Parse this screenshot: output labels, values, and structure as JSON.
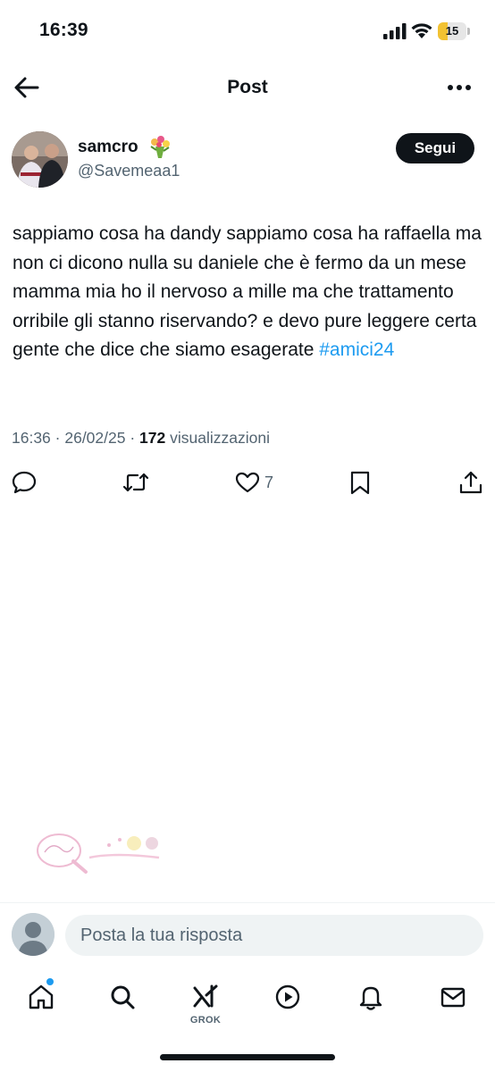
{
  "status_bar": {
    "time": "16:39",
    "battery_level": "15",
    "battery_fraction": 0.15
  },
  "header": {
    "title": "Post",
    "back_icon": "arrow-left-icon",
    "more_icon": "more-horizontal-icon"
  },
  "tweet": {
    "author_name": "samcro",
    "author_emoji": "bouquet-emoji",
    "author_handle": "@Savemeaa1",
    "follow_label": "Segui",
    "text_main": "sappiamo cosa ha dandy sappiamo cosa ha raffaella ma non ci dicono nulla su daniele che è fermo da un mese mamma mia ho il nervoso a mille ma che trattamento orribile gli stanno riservando? e devo pure leggere certa gente che dice che siamo esagerate ",
    "hashtag": "#amici24",
    "time": "16:36",
    "date": "26/02/25",
    "views_count": "172",
    "views_label": "visualizzazioni",
    "like_count": "7"
  },
  "actions": [
    {
      "icon": "reply-icon"
    },
    {
      "icon": "retweet-icon"
    },
    {
      "icon": "like-icon"
    },
    {
      "icon": "bookmark-icon"
    },
    {
      "icon": "share-icon"
    }
  ],
  "reply_bar": {
    "placeholder": "Posta la tua risposta"
  },
  "bottom_nav": {
    "items": [
      {
        "icon": "home-icon"
      },
      {
        "icon": "search-icon"
      },
      {
        "icon": "grok-icon",
        "label": "GROK"
      },
      {
        "icon": "video-icon"
      },
      {
        "icon": "notifications-icon"
      },
      {
        "icon": "messages-icon"
      }
    ]
  },
  "colors": {
    "text": "#0f1419",
    "secondary": "#536471",
    "accent": "#1d9bf0",
    "battery": "#f2c232"
  }
}
